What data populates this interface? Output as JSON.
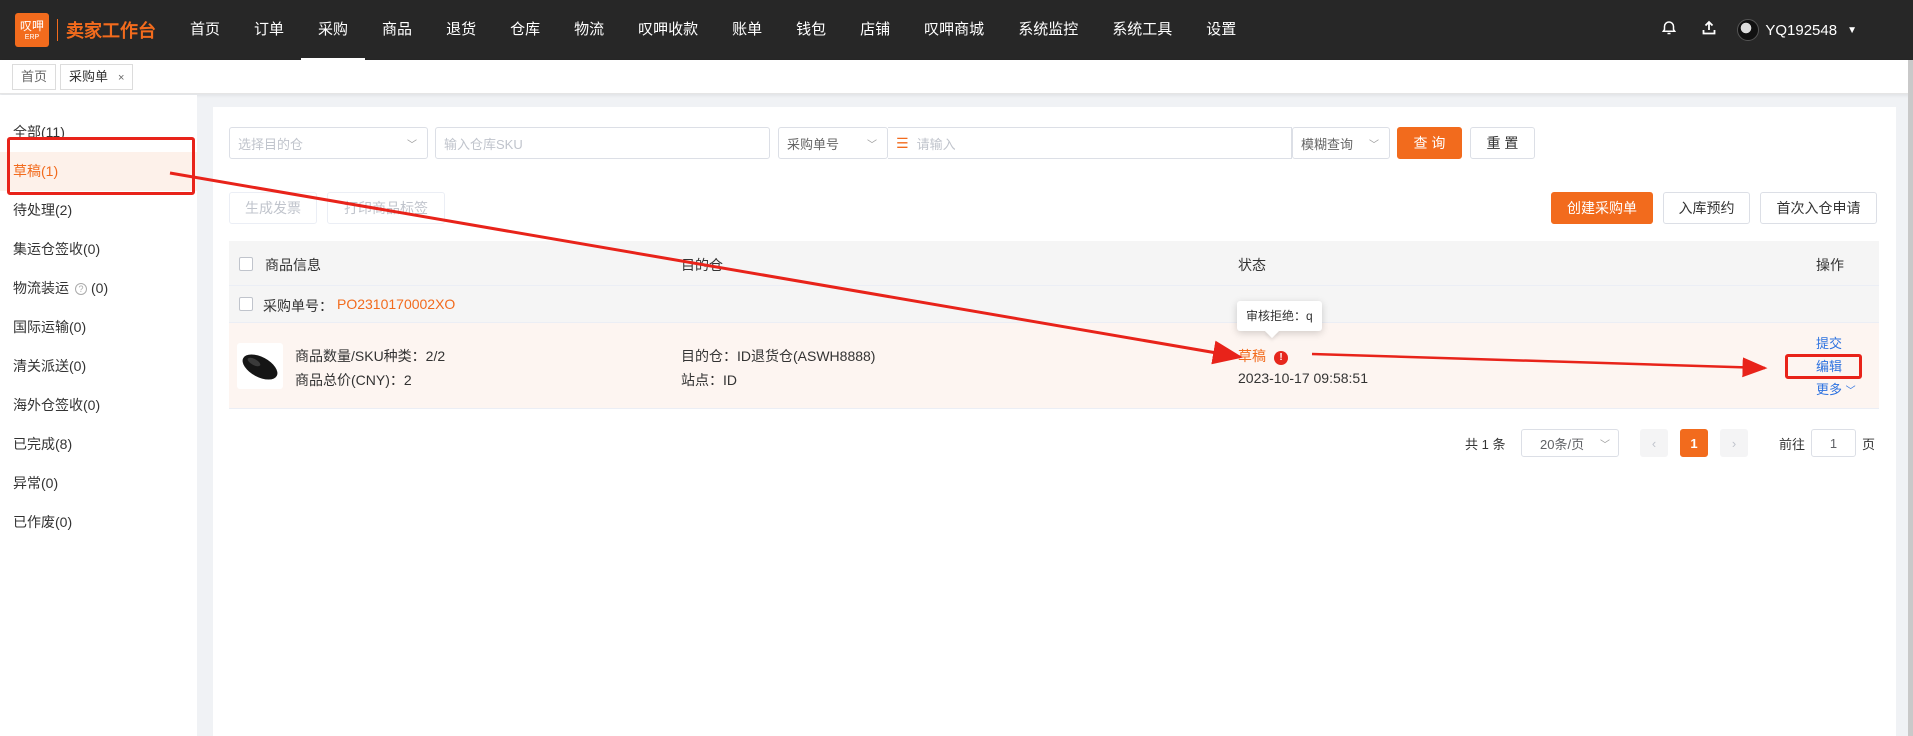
{
  "header": {
    "logo_line1": "叹呷",
    "logo_line2": "ERP",
    "title": "卖家工作台",
    "nav": [
      "首页",
      "订单",
      "采购",
      "商品",
      "退货",
      "仓库",
      "物流",
      "叹呷收款",
      "账单",
      "钱包",
      "店铺",
      "叹呷商城",
      "系统监控",
      "系统工具",
      "设置"
    ],
    "active_nav": "采购",
    "username": "YQ192548"
  },
  "tabs": [
    {
      "label": "首页",
      "closable": false
    },
    {
      "label": "采购单",
      "closable": true
    }
  ],
  "sidebar": {
    "items": [
      {
        "label": "全部(11)"
      },
      {
        "label": "草稿(1)",
        "active": true
      },
      {
        "label": "待处理(2)"
      },
      {
        "label": "集运仓签收(0)"
      },
      {
        "label": "物流装运",
        "suffix": "(0)"
      },
      {
        "label": "国际运输(0)"
      },
      {
        "label": "清关派送(0)"
      },
      {
        "label": "海外仓签收(0)"
      },
      {
        "label": "已完成(8)"
      },
      {
        "label": "异常(0)"
      },
      {
        "label": "已作废(0)"
      }
    ]
  },
  "filters": {
    "warehouse_placeholder": "选择目的仓",
    "sku_placeholder": "输入仓库SKU",
    "field_select": "采购单号",
    "keyword_placeholder": "请输入",
    "match_select": "模糊查询",
    "query_button": "查 询",
    "reset_button": "重 置"
  },
  "actions": {
    "generate_invoice": "生成发票",
    "print_label": "打印商品标签",
    "create_po": "创建采购单",
    "inbound_reservation": "入库预约",
    "first_inbound": "首次入仓申请"
  },
  "table": {
    "headers": {
      "product": "商品信息",
      "warehouse": "目的仓",
      "status": "状态",
      "ops": "操作"
    },
    "group": {
      "po_label": "采购单号：",
      "po_number": "PO2310170002XO"
    },
    "row": {
      "qty_line": "商品数量/SKU种类：2/2",
      "total_line": "商品总价(CNY)：2",
      "warehouse_line": "目的仓：ID退货仓(ASWH8888)",
      "site_line": "站点：ID",
      "status": "草稿",
      "status_time": "2023-10-17 09:58:51",
      "tooltip": "审核拒绝：q",
      "op_submit": "提交",
      "op_edit": "编辑",
      "op_more": "更多"
    }
  },
  "pagination": {
    "total": "共 1 条",
    "page_size": "20条/页",
    "current_page": "1",
    "goto_label": "前往",
    "goto_value": "1",
    "page_unit": "页"
  },
  "colors": {
    "brand": "#f26b1d",
    "link": "#2d72e0",
    "annotation": "#e8231a"
  }
}
